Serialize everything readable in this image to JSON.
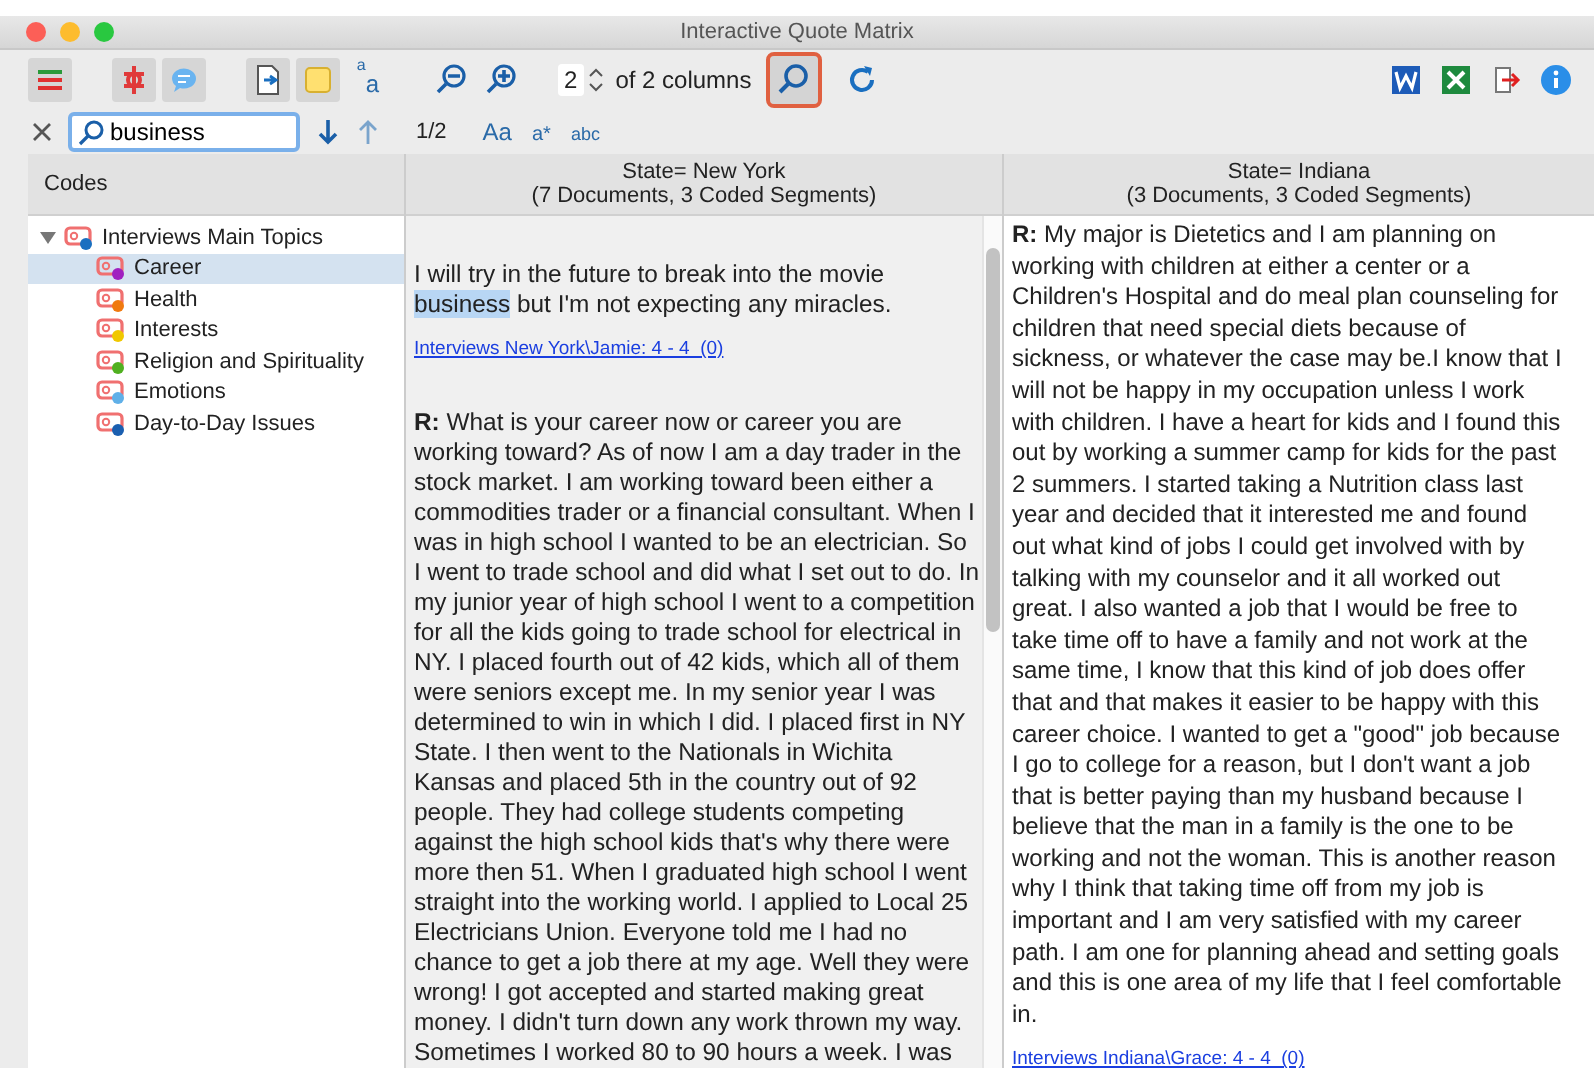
{
  "window": {
    "title": "Interactive Quote Matrix"
  },
  "toolbar": {
    "left_buttons": [
      {
        "kind": "code-list",
        "active": true
      },
      {
        "kind": "gap"
      },
      {
        "kind": "coding",
        "active": true
      },
      {
        "kind": "memo",
        "active": true
      },
      {
        "kind": "gap"
      },
      {
        "kind": "document",
        "active": true
      },
      {
        "kind": "note",
        "active": true
      },
      {
        "kind": "font",
        "active": false,
        "glyphs": [
          "a",
          "a"
        ]
      },
      {
        "kind": "gap"
      },
      {
        "kind": "zoom-out",
        "active": false
      },
      {
        "kind": "zoom-in",
        "active": false
      }
    ],
    "columns_spinner": {
      "value": "2",
      "label": "of 2 columns"
    },
    "search_toggle": {
      "selected": true
    },
    "right_buttons": [
      {
        "kind": "word"
      },
      {
        "kind": "excel"
      },
      {
        "kind": "export"
      },
      {
        "kind": "info"
      }
    ]
  },
  "search": {
    "value": "business",
    "position": "1/2",
    "options": [
      "Aa",
      "a*",
      "abc"
    ]
  },
  "codes": {
    "heading": "Codes",
    "tree": [
      {
        "label": "Interviews Main Topics",
        "color": "#1a6fc0",
        "expanded": true,
        "selected": false,
        "children": [
          {
            "label": "Career",
            "color": "#a020c0",
            "selected": true
          },
          {
            "label": "Health",
            "color": "#f07a10",
            "selected": false
          },
          {
            "label": "Interests",
            "color": "#f0c800",
            "selected": false
          },
          {
            "label": "Religion and Spirituality",
            "color": "#50b020",
            "selected": false
          },
          {
            "label": "Emotions",
            "color": "#60b0e8",
            "selected": false
          },
          {
            "label": "Day-to-Day Issues",
            "color": "#1a5fb0",
            "selected": false
          }
        ]
      }
    ]
  },
  "matrix_columns": [
    {
      "title": "State= New York",
      "subtitle": "(7 Documents, 3 Coded Segments)",
      "segments": [
        {
          "parts": [
            {
              "text": "I will try in the future to break into the movie ",
              "highlighted": false
            },
            {
              "text": "business",
              "highlighted": true
            },
            {
              "text": " but I'm not expecting any miracles.",
              "highlighted": false
            }
          ],
          "source": "Interviews New York\\Jamie: 4 - 4  (0)"
        },
        {
          "parts": [
            {
              "text": "**R:** What is your career now or career you are working toward? As of now I am a day trader in the stock market. I am working toward been either a commodities trader or a financial consultant. When I was in high school I wanted to be an electrician. So I went to trade school and did what I set out to do. In my junior year of high school I went to a competition for all the kids going to trade school for electrical in NY. I placed fourth out of 42 kids, which all of them were seniors except me. In my senior year I was determined to win in which I did. I placed first in NY State. I then went to the Nationals in Wichita Kansas and placed 5th in the country out of 92 people. They had college students competing against the high school kids that's why there were more then 51. When I graduated high school I went straight into the working world. I applied to Local 25 Electricians Union. Everyone told me I had no chance to get a job there at my age. Well they were wrong! I got accepted and started making great money. I didn't turn down any work thrown my way. Sometimes I worked 80 to 90 hours a week. I was",
              "highlighted": false
            }
          ]
        }
      ]
    },
    {
      "title": "State= Indiana",
      "subtitle": "(3 Documents, 3 Coded Segments)",
      "segments": [
        {
          "parts": [
            {
              "text": "**R:** My major is Dietetics and I am planning on working with children at either a center or a Children's Hospital and do meal plan counseling for children that need special diets because of sickness, or whatever the case may be.I know that I will not be happy in my occupation unless I work with children. I have a heart for kids and I found this out by working a summer camp for kids for the past 2 summers. I started taking a Nutrition class last year and decided that it interested me and found out what kind of jobs I could get involved with by talking with my counselor and it all worked out great. I also wanted a job that I would be free to take time off to have a family and not work at the same time, I know that this kind of job does offer that and that makes it easier to be happy with this career choice. I wanted to get a \"good\" job because I go to college for a reason, but I don't want a job that is better paying than my husband because I believe that the man in a family is the one to be working and not the woman. This is another reason why I think that taking time off from my job is important and I am very satisfied with my career path. I am one for planning ahead and setting goals and this is one area of my life that I feel comfortable in.",
              "highlighted": false
            }
          ],
          "source": "Interviews Indiana\\Grace: 4 - 4  (0)"
        }
      ]
    }
  ]
}
